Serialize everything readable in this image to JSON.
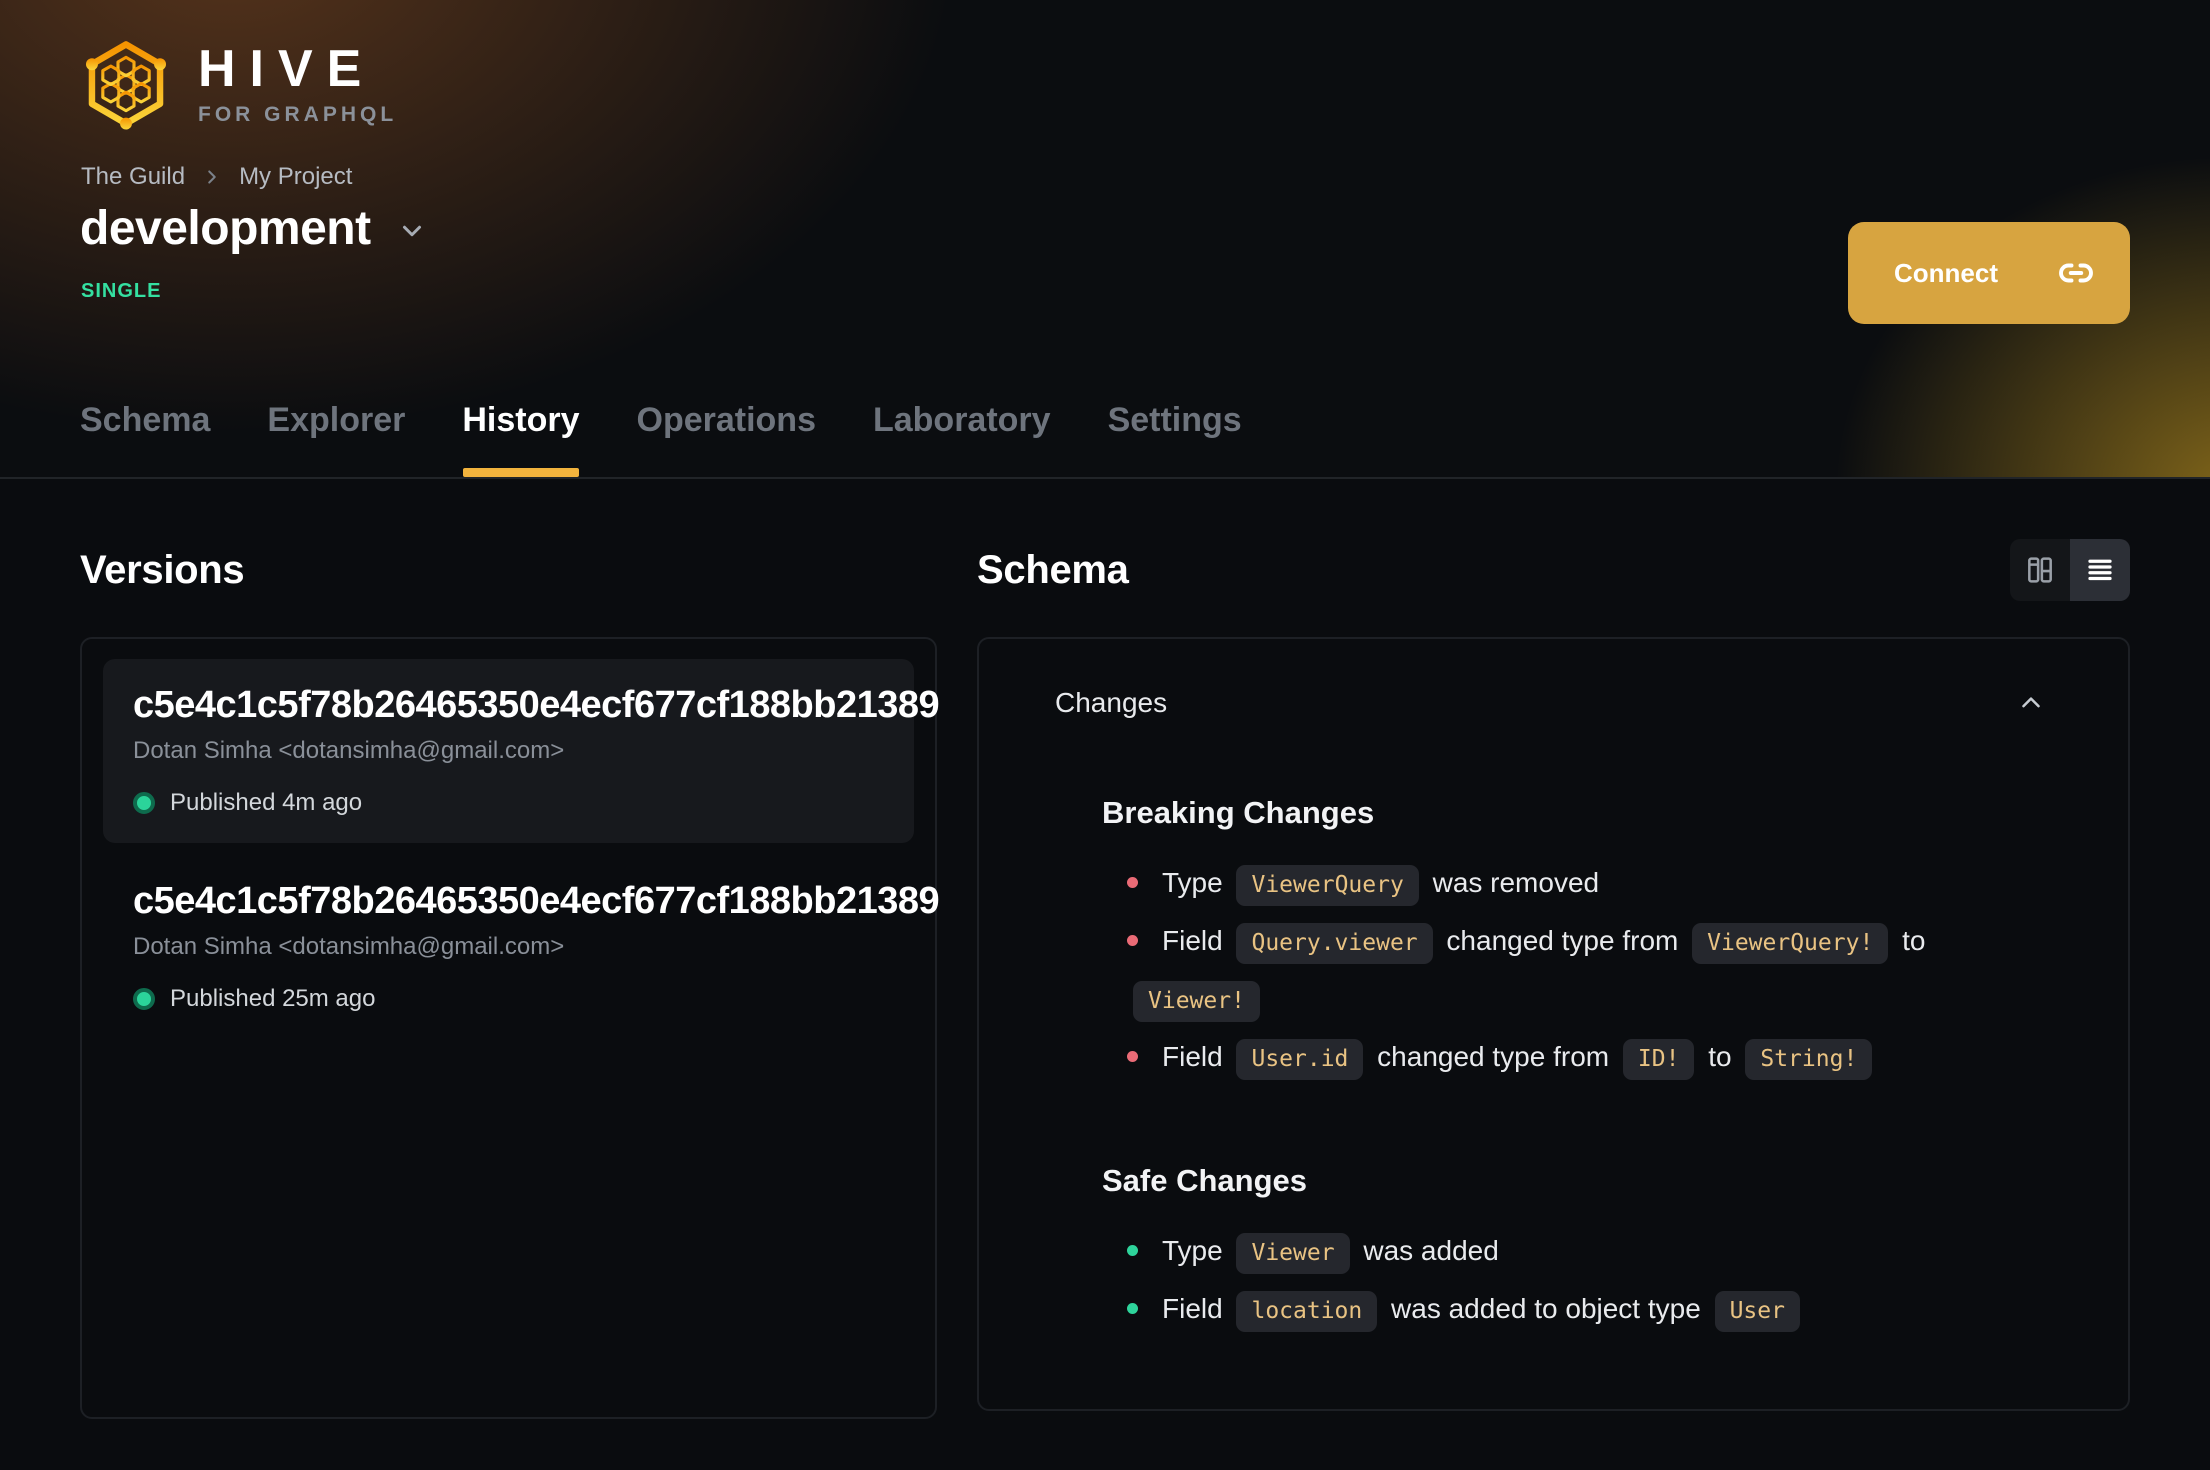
{
  "brand": {
    "name": "HIVE",
    "tagline": "FOR GRAPHQL"
  },
  "breadcrumb": {
    "items": [
      "The Guild",
      "My Project"
    ]
  },
  "target": {
    "name": "development",
    "badge": "SINGLE"
  },
  "actions": {
    "connect_label": "Connect"
  },
  "tabs": [
    {
      "label": "Schema",
      "active": false
    },
    {
      "label": "Explorer",
      "active": false
    },
    {
      "label": "History",
      "active": true
    },
    {
      "label": "Operations",
      "active": false
    },
    {
      "label": "Laboratory",
      "active": false
    },
    {
      "label": "Settings",
      "active": false
    }
  ],
  "versions": {
    "title": "Versions",
    "items": [
      {
        "hash": "c5e4c1c5f78b26465350e4ecf677cf188bb21389",
        "author": "Dotan Simha <dotansimha@gmail.com>",
        "status": "Published 4m ago",
        "selected": true
      },
      {
        "hash": "c5e4c1c5f78b26465350e4ecf677cf188bb21389",
        "author": "Dotan Simha <dotansimha@gmail.com>",
        "status": "Published 25m ago",
        "selected": false
      }
    ]
  },
  "schema": {
    "title": "Schema",
    "changes_label": "Changes",
    "sections": [
      {
        "kind": "breaking",
        "title": "Breaking Changes",
        "items": [
          [
            {
              "text": "Type"
            },
            {
              "code": "ViewerQuery"
            },
            {
              "text": "was removed"
            }
          ],
          [
            {
              "text": "Field"
            },
            {
              "code": "Query.viewer"
            },
            {
              "text": "changed type from"
            },
            {
              "code": "ViewerQuery!"
            },
            {
              "text": "to"
            },
            {
              "code": "Viewer!"
            }
          ],
          [
            {
              "text": "Field"
            },
            {
              "code": "User.id"
            },
            {
              "text": "changed type from"
            },
            {
              "code": "ID!"
            },
            {
              "text": "to"
            },
            {
              "code": "String!"
            }
          ]
        ]
      },
      {
        "kind": "safe",
        "title": "Safe Changes",
        "items": [
          [
            {
              "text": "Type"
            },
            {
              "code": "Viewer"
            },
            {
              "text": "was added"
            }
          ],
          [
            {
              "text": "Field"
            },
            {
              "code": "location"
            },
            {
              "text": "was added to object type"
            },
            {
              "code": "User"
            }
          ]
        ]
      }
    ]
  },
  "colors": {
    "accent": "#f2b33d",
    "button": "#d7a440",
    "emerald": "#34e0a1",
    "breaking": "#ea6b76",
    "safe": "#2ed49b",
    "chip_text": "#e9c383",
    "chip_bg": "#25272d"
  }
}
